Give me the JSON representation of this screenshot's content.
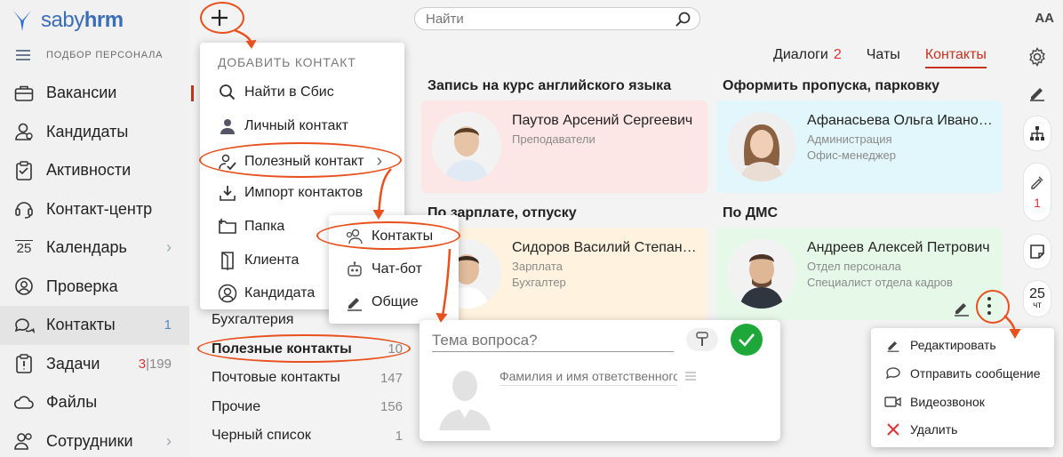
{
  "app": {
    "logo_pre": "saby",
    "logo_post": "hrm",
    "section": "ПОДБОР ПЕРСОНАЛА",
    "font_toggle": "AA"
  },
  "sidebar": {
    "items": [
      {
        "label": "Вакансии"
      },
      {
        "label": "Кандидаты"
      },
      {
        "label": "Активности"
      },
      {
        "label": "Контакт-центр"
      },
      {
        "label": "Календарь",
        "day": "25"
      },
      {
        "label": "Проверка"
      },
      {
        "label": "Контакты",
        "count": "1"
      },
      {
        "label": "Задачи",
        "count_red": "3",
        "count_sep": "|",
        "count_grey": "199"
      },
      {
        "label": "Файлы"
      },
      {
        "label": "Сотрудники"
      }
    ]
  },
  "search": {
    "placeholder": "Найти"
  },
  "tabs": [
    {
      "label": "Диалоги",
      "badge": "2"
    },
    {
      "label": "Чаты"
    },
    {
      "label": "Контакты"
    }
  ],
  "add_menu": {
    "title": "ДОБАВИТЬ КОНТАКТ",
    "items": [
      {
        "label": "Найти в Сбис"
      },
      {
        "label": "Личный контакт"
      },
      {
        "label": "Полезный контакт",
        "chevron": "›"
      },
      {
        "label": "Импорт контактов"
      },
      {
        "label": "Папка"
      },
      {
        "label": "Клиента"
      },
      {
        "label": "Кандидата"
      }
    ]
  },
  "submenu": {
    "items": [
      {
        "label": "Контакты"
      },
      {
        "label": "Чат-бот"
      },
      {
        "label": "Общие"
      }
    ]
  },
  "folders": [
    {
      "label": "Бухгалтерия",
      "count": ""
    },
    {
      "label": "Полезные контакты",
      "count": "10"
    },
    {
      "label": "Почтовые контакты",
      "count": "147"
    },
    {
      "label": "Прочие",
      "count": "156"
    },
    {
      "label": "Черный список",
      "count": "1"
    }
  ],
  "groups": [
    {
      "title": "Запись на курс английского языка",
      "name": "Паутов Арсений Сергеевич",
      "line1": "Преподаватели",
      "line2": "",
      "bg": "#fde6e6"
    },
    {
      "title": "Оформить пропуска, парковку",
      "name": "Афанасьева Ольга Ивановна",
      "line1": "Администрация",
      "line2": "Офис-менеджер",
      "bg": "#e2f7fb"
    },
    {
      "title": "По зарплате, отпуску",
      "name": "Сидоров Василий Степанович",
      "line1": "Зарплата",
      "line2": "Бухгалтер",
      "bg": "#fff3df"
    },
    {
      "title": "По ДМС",
      "name": "Андреев Алексей Петрович",
      "line1": "Отдел персонала",
      "line2": "Специалист отдела кадров",
      "bg": "#e6f8e8"
    }
  ],
  "new_contact": {
    "topic_placeholder": "Тема вопроса?",
    "person_placeholder": "Фамилия и имя ответственного"
  },
  "context_menu": {
    "items": [
      {
        "label": "Редактировать"
      },
      {
        "label": "Отправить сообщение"
      },
      {
        "label": "Видеозвонок"
      },
      {
        "label": "Удалить"
      }
    ]
  },
  "calendar_widget": {
    "day": "25",
    "weekday": "чт"
  },
  "tool_badge": "1",
  "colors": {
    "accent": "#c8321e",
    "highlight": "#e8501e",
    "brand": "#3a6fb5",
    "ok": "#1fa83a"
  }
}
